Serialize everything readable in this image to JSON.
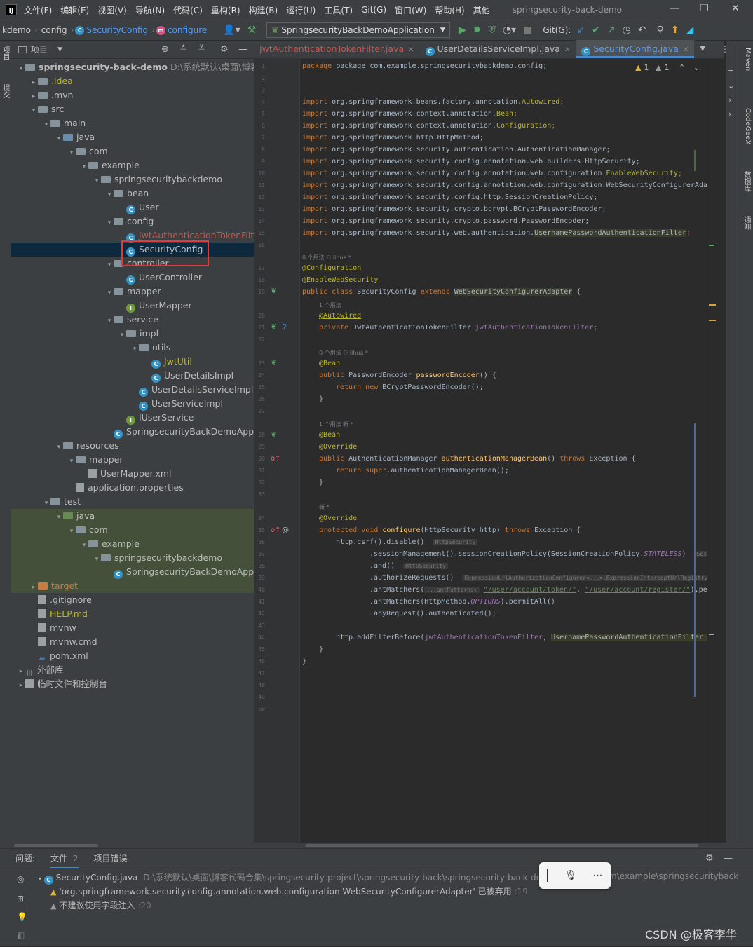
{
  "menubar": {
    "logo": "IJ",
    "items": [
      "文件(F)",
      "编辑(E)",
      "视图(V)",
      "导航(N)",
      "代码(C)",
      "重构(R)",
      "构建(B)",
      "运行(U)",
      "工具(T)",
      "Git(G)",
      "窗口(W)",
      "帮助(H)",
      "其他"
    ],
    "window_title": "springsecurity-back-demo"
  },
  "navbar": {
    "crumbs": [
      "kdemo",
      "config",
      "SecurityConfig",
      "configure"
    ],
    "run_config": "SpringsecurityBackDemoApplication",
    "git_label": "Git(G):"
  },
  "leftstrip": {
    "project_label": "项目",
    "commit_label": "提交"
  },
  "project": {
    "header": "项目",
    "rows": [
      {
        "label": "springsecurity-back-demo",
        "path": "D:\\系统默认\\桌面\\博客代",
        "icon": "folder",
        "depth": 0,
        "exp": "▾",
        "bold": true
      },
      {
        "label": ".idea",
        "icon": "folder",
        "depth": 1,
        "exp": "▸",
        "color": "yellow"
      },
      {
        "label": ".mvn",
        "icon": "folder",
        "depth": 1,
        "exp": "▸"
      },
      {
        "label": "src",
        "icon": "folder",
        "depth": 1,
        "exp": "▾"
      },
      {
        "label": "main",
        "icon": "folder",
        "depth": 2,
        "exp": "▾"
      },
      {
        "label": "java",
        "icon": "folder-b",
        "depth": 3,
        "exp": "▾"
      },
      {
        "label": "com",
        "icon": "folder",
        "depth": 4,
        "exp": "▾"
      },
      {
        "label": "example",
        "icon": "folder",
        "depth": 5,
        "exp": "▾"
      },
      {
        "label": "springsecuritybackdemo",
        "icon": "folder",
        "depth": 6,
        "exp": "▾"
      },
      {
        "label": "bean",
        "icon": "folder",
        "depth": 7,
        "exp": "▾"
      },
      {
        "label": "User",
        "icon": "class",
        "depth": 8,
        "exp": ""
      },
      {
        "label": "config",
        "icon": "folder",
        "depth": 7,
        "exp": "▾"
      },
      {
        "label": "JwtAuthenticationTokenFilter",
        "icon": "class",
        "depth": 8,
        "exp": "",
        "color": "red"
      },
      {
        "label": "SecurityConfig",
        "icon": "class",
        "depth": 8,
        "exp": "",
        "sel": true
      },
      {
        "label": "controller",
        "icon": "folder",
        "depth": 7,
        "exp": "▾"
      },
      {
        "label": "UserController",
        "icon": "class",
        "depth": 8,
        "exp": ""
      },
      {
        "label": "mapper",
        "icon": "folder",
        "depth": 7,
        "exp": "▾"
      },
      {
        "label": "UserMapper",
        "icon": "interface",
        "depth": 8,
        "exp": ""
      },
      {
        "label": "service",
        "icon": "folder",
        "depth": 7,
        "exp": "▾"
      },
      {
        "label": "impl",
        "icon": "folder",
        "depth": 8,
        "exp": "▾"
      },
      {
        "label": "utils",
        "icon": "folder",
        "depth": 9,
        "exp": "▾"
      },
      {
        "label": "JwtUtil",
        "icon": "class",
        "depth": 10,
        "exp": "",
        "color": "yellow"
      },
      {
        "label": "UserDetailsImpl",
        "icon": "class",
        "depth": 10,
        "exp": ""
      },
      {
        "label": "UserDetailsServiceImpl",
        "icon": "class",
        "depth": 9,
        "exp": ""
      },
      {
        "label": "UserServiceImpl",
        "icon": "class",
        "depth": 9,
        "exp": ""
      },
      {
        "label": "IUserService",
        "icon": "interface",
        "depth": 8,
        "exp": ""
      },
      {
        "label": "SpringsecurityBackDemoAppli",
        "icon": "class",
        "depth": 7,
        "exp": ""
      },
      {
        "label": "resources",
        "icon": "folder",
        "depth": 3,
        "exp": "▾"
      },
      {
        "label": "mapper",
        "icon": "folder",
        "depth": 4,
        "exp": "▾"
      },
      {
        "label": "UserMapper.xml",
        "icon": "file",
        "depth": 5,
        "exp": ""
      },
      {
        "label": "application.properties",
        "icon": "file",
        "depth": 4,
        "exp": ""
      },
      {
        "label": "test",
        "icon": "folder",
        "depth": 2,
        "exp": "▾"
      },
      {
        "label": "java",
        "icon": "folder-g",
        "depth": 3,
        "exp": "▾",
        "hl": true
      },
      {
        "label": "com",
        "icon": "folder",
        "depth": 4,
        "exp": "▾",
        "hl": true
      },
      {
        "label": "example",
        "icon": "folder",
        "depth": 5,
        "exp": "▾",
        "hl": true
      },
      {
        "label": "springsecuritybackdemo",
        "icon": "folder",
        "depth": 6,
        "exp": "▾",
        "hl": true
      },
      {
        "label": "SpringsecurityBackDemoAppli",
        "icon": "class",
        "depth": 7,
        "exp": "",
        "hl": true
      },
      {
        "label": "target",
        "icon": "folder-o",
        "depth": 1,
        "exp": "▸",
        "color": "orange",
        "hl": true
      },
      {
        "label": ".gitignore",
        "icon": "file",
        "depth": 1,
        "exp": ""
      },
      {
        "label": "HELP.md",
        "icon": "file",
        "depth": 1,
        "exp": "",
        "color": "yellow"
      },
      {
        "label": "mvnw",
        "icon": "file",
        "depth": 1,
        "exp": ""
      },
      {
        "label": "mvnw.cmd",
        "icon": "file",
        "depth": 1,
        "exp": ""
      },
      {
        "label": "pom.xml",
        "icon": "m-file",
        "depth": 1,
        "exp": ""
      },
      {
        "label": "外部库",
        "icon": "lib",
        "depth": 0,
        "exp": "▸"
      },
      {
        "label": "临时文件和控制台",
        "icon": "scratch",
        "depth": 0,
        "exp": "▸"
      }
    ]
  },
  "editor": {
    "tabs": [
      {
        "label": "JwtAuthenticationTokenFilter.java",
        "color": "red",
        "active": false
      },
      {
        "label": "UserDetailsServiceImpl.java",
        "color": "normal",
        "active": false
      },
      {
        "label": "SecurityConfig.java",
        "color": "blue",
        "active": true
      }
    ],
    "inspection": {
      "warn1": "1",
      "warn2": "1"
    },
    "line_count": 50
  },
  "code": {
    "l1": "package com.example.springsecuritybackdemo.config;",
    "imports": [
      "org.springframework.beans.factory.annotation.",
      "org.springframework.context.annotation.",
      "org.springframework.context.annotation.",
      "org.springframework.http.HttpMethod;",
      "org.springframework.security.authentication.AuthenticationManager;",
      "org.springframework.security.config.annotation.web.builders.HttpSecurity;",
      "org.springframework.security.config.annotation.web.configuration.",
      "org.springframework.security.config.annotation.web.configuration.WebSecurityConfigurerAda",
      "org.springframework.security.config.http.SessionCreationPolicy;",
      "org.springframework.security.crypto.bcrypt.BCryptPasswordEncoder;",
      "org.springframework.security.crypto.password.PasswordEncoder;",
      "org.springframework.security.web.authentication."
    ],
    "import_tails": [
      "Autowired",
      "Bean",
      "Configuration",
      "",
      "",
      "",
      "EnableWebSecurity",
      "",
      "",
      "",
      "",
      "UsernamePasswordAuthenticationFilter"
    ],
    "kw_import": "import",
    "hint1": "0 个用法  ⚇ lihua *",
    "ann_config": "@Configuration",
    "ann_ews": "@EnableWebSecurity",
    "class_decl_1": "public class",
    "class_name": " SecurityConfig ",
    "kw_extends": "extends",
    "super_name": "WebSecurityConfigurerAdapter",
    "brace_open": " {",
    "hint2": "1 个用法",
    "ann_autowired": "@Autowired",
    "kw_private": "private",
    "field_type": " JwtAuthenticationTokenFilter ",
    "field_name": "jwtAuthenticationTokenFilter",
    "semi": ";",
    "hint3": "0 个用法  ⚇ lihua *",
    "ann_bean": "@Bean",
    "kw_public": "public",
    "pe_type": " PasswordEncoder ",
    "pe_name": "passwordEncoder",
    "pe_tail": "() {",
    "kw_return": "return",
    "kw_new": " new",
    "pe_ret": " BCryptPasswordEncoder();",
    "close": "}",
    "hint4": "1 个用法   新 *",
    "ann_override": "@Override",
    "am_type": " AuthenticationManager ",
    "am_name": "authenticationManagerBean",
    "kw_throws": "throws",
    "am_tail2": " Exception {",
    "kw_super": " super",
    "am_ret": ".authenticationManagerBean();",
    "hint5": "新 *",
    "kw_protected": "protected",
    "kw_void": " void ",
    "cfg_name": "configure",
    "cfg_params": "(HttpSecurity http) ",
    "c36": "http.csrf().disable()",
    "c36h": "HttpSecurity",
    "c37a": ".sessionManagement().sessionCreationPolicy(SessionCreationPolicy.",
    "c37b": "STATELESS",
    "c37c": ")",
    "c37h": "Sessio",
    "c38": ".and()",
    "c38h": "HttpSecurity",
    "c39": ".authorizeRequests()",
    "c39h": "ExpressionUrlAuthorizationConfigurer<...>.ExpressionInterceptUrlRegistry",
    "c40a": ".antMatchers(",
    "c40h": "...antPatterns:",
    "c40s1": "\"/user/account/token/\"",
    "c40m": ", ",
    "c40s2": "\"/user/account/register/\"",
    "c40e": ").perm:",
    "c41a": ".antMatchers(HttpMethod.",
    "c41b": "OPTIONS",
    "c41c": ").permitAll()",
    "c42": ".anyRequest().authenticated();",
    "c44a": "http.addFilterBefore(",
    "c44b": "jwtAuthenticationTokenFilter",
    "c44c": ", ",
    "c44d": "UsernamePasswordAuthenticationFilter.",
    "close_inner": "}",
    "close_outer": "}"
  },
  "rightpanel": {
    "maven": "Maven",
    "codegeex": "CodeGeeX",
    "db": "数据库",
    "notify": "通知"
  },
  "bottom": {
    "tabs": [
      {
        "label": "问题:",
        "active": false
      },
      {
        "label": "文件",
        "count": "2",
        "active": true
      },
      {
        "label": "项目错误",
        "active": false
      }
    ],
    "file": "SecurityConfig.java",
    "file_path": "D:\\系统默认\\桌面\\博客代码合集\\springsecurity-project\\springsecurity-back\\springsecurity-back-demo",
    "file_path_tail": "m\\example\\springsecurityback",
    "w1": "'org.springframework.security.config.annotation.web.configuration.WebSecurityConfigurerAdapter' 已被弃用",
    "w1l": ":19",
    "w2": "不建议使用字段注入",
    "w2l": ":20"
  },
  "floatbar": {
    "items": [
      "mic-icon",
      "more-icon"
    ]
  },
  "watermark": "CSDN @极客李华"
}
